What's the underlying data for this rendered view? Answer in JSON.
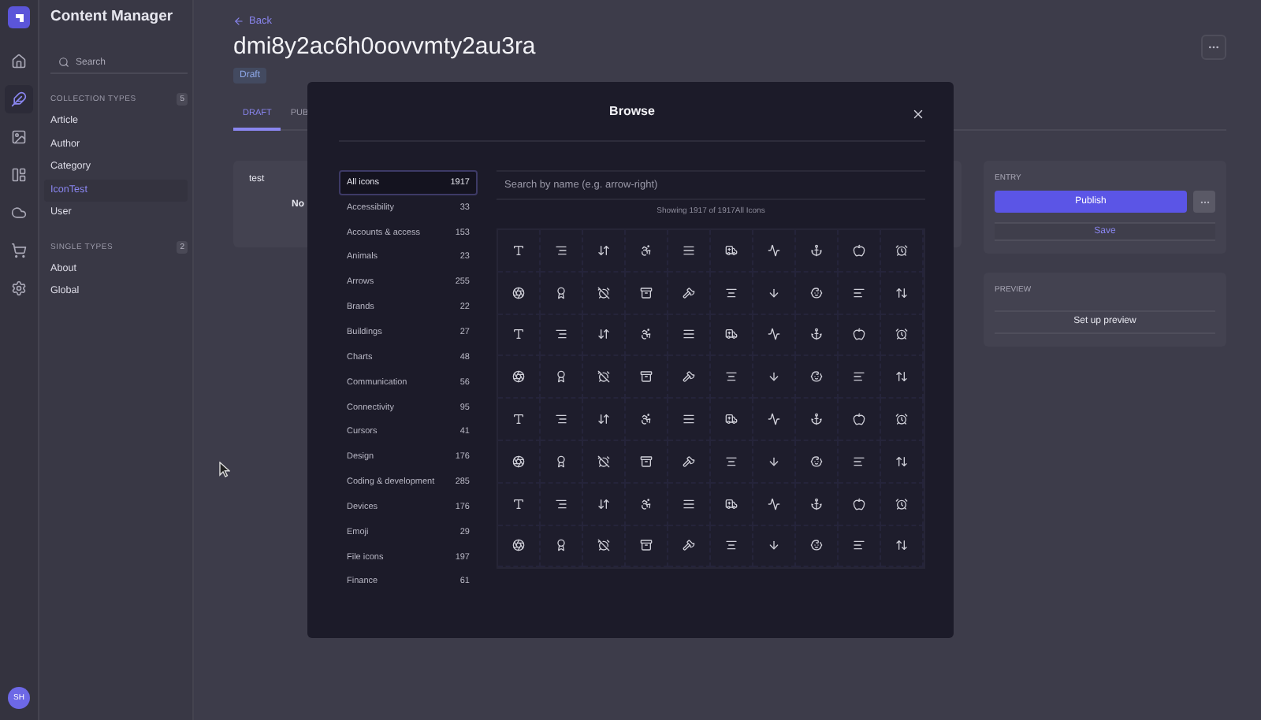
{
  "rail": {
    "items": [
      {
        "kind": "home",
        "selected": false
      },
      {
        "kind": "content",
        "selected": true
      },
      {
        "kind": "media",
        "selected": false
      },
      {
        "kind": "builder",
        "selected": false
      },
      {
        "kind": "cloud",
        "selected": false
      },
      {
        "kind": "cart",
        "selected": false
      },
      {
        "kind": "settings",
        "selected": false
      }
    ],
    "avatar": "SH"
  },
  "sidebar": {
    "title": "Content Manager",
    "search": {
      "placeholder": "Search"
    },
    "sections": [
      {
        "title": "COLLECTION TYPES",
        "count": "5",
        "items": [
          {
            "label": "Article",
            "selected": false
          },
          {
            "label": "Author",
            "selected": false
          },
          {
            "label": "Category",
            "selected": false
          },
          {
            "label": "IconTest",
            "selected": true
          },
          {
            "label": "User",
            "selected": false
          }
        ]
      },
      {
        "title": "SINGLE TYPES",
        "count": "2",
        "items": [
          {
            "label": "About",
            "selected": false
          },
          {
            "label": "Global",
            "selected": false
          }
        ]
      }
    ]
  },
  "main": {
    "back": "Back",
    "title": "dmi8y2ac6h0oovvmty2au3ra",
    "status": "Draft",
    "tabs": [
      {
        "label": "DRAFT",
        "selected": true
      },
      {
        "label": "PUB",
        "selected": false
      }
    ],
    "card": {
      "title": "test",
      "text": "No"
    },
    "entry": {
      "heading": "ENTRY",
      "publish": "Publish",
      "save": "Save"
    },
    "preview": {
      "heading": "PREVIEW",
      "action": "Set up preview"
    }
  },
  "modal": {
    "title": "Browse",
    "search": {
      "placeholder": "Search by name (e.g. arrow-right)"
    },
    "summary": "Showing 1917 of 1917All Icons",
    "categories": [
      {
        "label": "All icons",
        "count": "1917",
        "selected": true
      },
      {
        "label": "Accessibility",
        "count": "33",
        "selected": false
      },
      {
        "label": "Accounts & access",
        "count": "153",
        "selected": false
      },
      {
        "label": "Animals",
        "count": "23",
        "selected": false
      },
      {
        "label": "Arrows",
        "count": "255",
        "selected": false
      },
      {
        "label": "Brands",
        "count": "22",
        "selected": false
      },
      {
        "label": "Buildings",
        "count": "27",
        "selected": false
      },
      {
        "label": "Charts",
        "count": "48",
        "selected": false
      },
      {
        "label": "Communication",
        "count": "56",
        "selected": false
      },
      {
        "label": "Connectivity",
        "count": "95",
        "selected": false
      },
      {
        "label": "Cursors",
        "count": "41",
        "selected": false
      },
      {
        "label": "Design",
        "count": "176",
        "selected": false
      },
      {
        "label": "Coding & development",
        "count": "285",
        "selected": false
      },
      {
        "label": "Devices",
        "count": "176",
        "selected": false
      },
      {
        "label": "Emoji",
        "count": "29",
        "selected": false
      },
      {
        "label": "File icons",
        "count": "197",
        "selected": false
      },
      {
        "label": "Finance",
        "count": "61",
        "selected": false
      }
    ]
  }
}
